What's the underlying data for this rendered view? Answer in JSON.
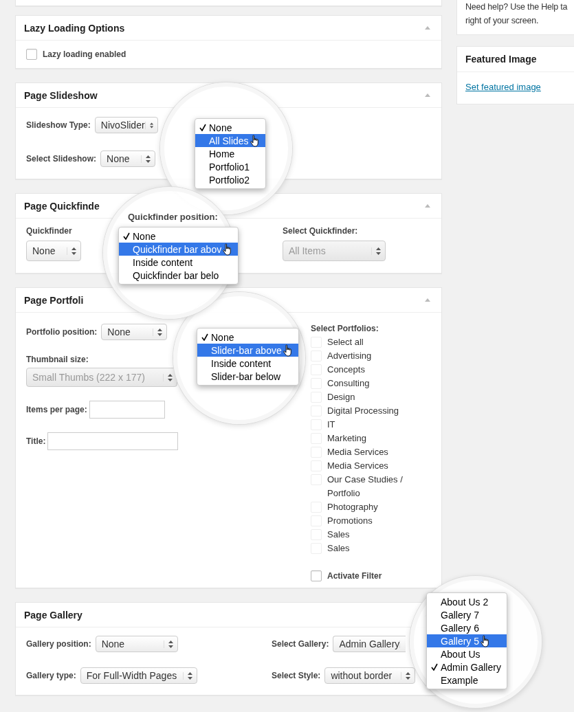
{
  "help_box": {
    "lines": [
      "Need help? Use the Help ta",
      "right of your screen."
    ]
  },
  "featured_image": {
    "title": "Featured Image",
    "link": "Set featured image"
  },
  "lazy_loading": {
    "title": "Lazy Loading Options",
    "option": {
      "label": "Lazy loading enabled",
      "checked": false
    }
  },
  "slideshow": {
    "title": "Page Slideshow",
    "fields": [
      {
        "label": "Slideshow Type:",
        "value": "NivoSlider",
        "disabled": false
      },
      {
        "label": "Select Slideshow:",
        "value": "None",
        "disabled": false
      }
    ],
    "menu": {
      "items": [
        {
          "label": "None",
          "checked": true,
          "selected": false
        },
        {
          "label": "All Slides",
          "checked": false,
          "selected": true
        },
        {
          "label": "Home",
          "checked": false,
          "selected": false
        },
        {
          "label": "Portfolio1",
          "checked": false,
          "selected": false
        },
        {
          "label": "Portfolio2",
          "checked": false,
          "selected": false
        }
      ]
    }
  },
  "quickfinder": {
    "title": "Page Quickfinde",
    "fields": [
      {
        "label": "Quickfinder",
        "value": "None",
        "disabled": false
      },
      {
        "label": "Select Quickfinder:",
        "value": "All Items",
        "disabled": true
      }
    ],
    "menu": {
      "label": "Quickfinder position:",
      "items": [
        {
          "label": "None",
          "checked": true,
          "selected": false
        },
        {
          "label": "Quickfinder bar abov",
          "checked": false,
          "selected": true
        },
        {
          "label": "Inside content",
          "checked": false,
          "selected": false
        },
        {
          "label": "Quickfinder bar belo",
          "checked": false,
          "selected": false
        }
      ]
    }
  },
  "portfolio": {
    "title": "Page Portfoli",
    "selects": [
      {
        "label": "Portfolio position:",
        "value": "None",
        "disabled": false
      },
      {
        "label": "Thumbnail size:",
        "value": "Small Thumbs (222 x 177)",
        "disabled": true
      }
    ],
    "inputs": [
      {
        "label": "Items per page:"
      },
      {
        "label": "Title:"
      }
    ],
    "categories": {
      "heading": "Select Portfolios:",
      "items": [
        {
          "label": "Select all",
          "checked": false
        },
        {
          "label": "Advertising",
          "checked": false
        },
        {
          "label": "Concepts",
          "checked": false
        },
        {
          "label": "Consulting",
          "checked": false
        },
        {
          "label": "Design",
          "checked": false
        },
        {
          "label": "Digital Processing",
          "checked": false
        },
        {
          "label": "IT",
          "checked": false
        },
        {
          "label": "Marketing",
          "checked": false
        },
        {
          "label": "Media Services",
          "checked": false
        },
        {
          "label": "Media Services",
          "checked": false
        },
        {
          "label": "Our Case Studies / Portfolio",
          "checked": false
        },
        {
          "label": "Photography",
          "checked": false
        },
        {
          "label": "Promotions",
          "checked": false
        },
        {
          "label": "Sales",
          "checked": false
        },
        {
          "label": "Sales",
          "checked": false
        }
      ]
    },
    "filter": {
      "label": "Activate Filter",
      "checked": false
    },
    "menu": {
      "items": [
        {
          "label": "None",
          "checked": true,
          "selected": false
        },
        {
          "label": "Slider-bar above",
          "checked": false,
          "selected": true
        },
        {
          "label": "Inside content",
          "checked": false,
          "selected": false
        },
        {
          "label": "Slider-bar below",
          "checked": false,
          "selected": false
        }
      ]
    }
  },
  "gallery": {
    "title": "Page Gallery",
    "fields": [
      {
        "label": "Gallery position:",
        "value": "None",
        "disabled": false
      },
      {
        "label": "Select Gallery:",
        "value": "Admin Gallery",
        "disabled": false
      },
      {
        "label": "Gallery type:",
        "value": "For Full-Width Pages",
        "disabled": false
      },
      {
        "label": "Select Style:",
        "value": "without border",
        "disabled": false
      }
    ],
    "menu": {
      "items": [
        {
          "label": "About Us 2",
          "checked": false,
          "selected": false
        },
        {
          "label": "Gallery 7",
          "checked": false,
          "selected": false
        },
        {
          "label": "Gallery 6",
          "checked": false,
          "selected": false
        },
        {
          "label": "Gallery 5",
          "checked": false,
          "selected": true
        },
        {
          "label": "About Us",
          "checked": false,
          "selected": false
        },
        {
          "label": "Admin Gallery",
          "checked": true,
          "selected": false
        },
        {
          "label": "Example",
          "checked": false,
          "selected": false
        }
      ]
    }
  }
}
